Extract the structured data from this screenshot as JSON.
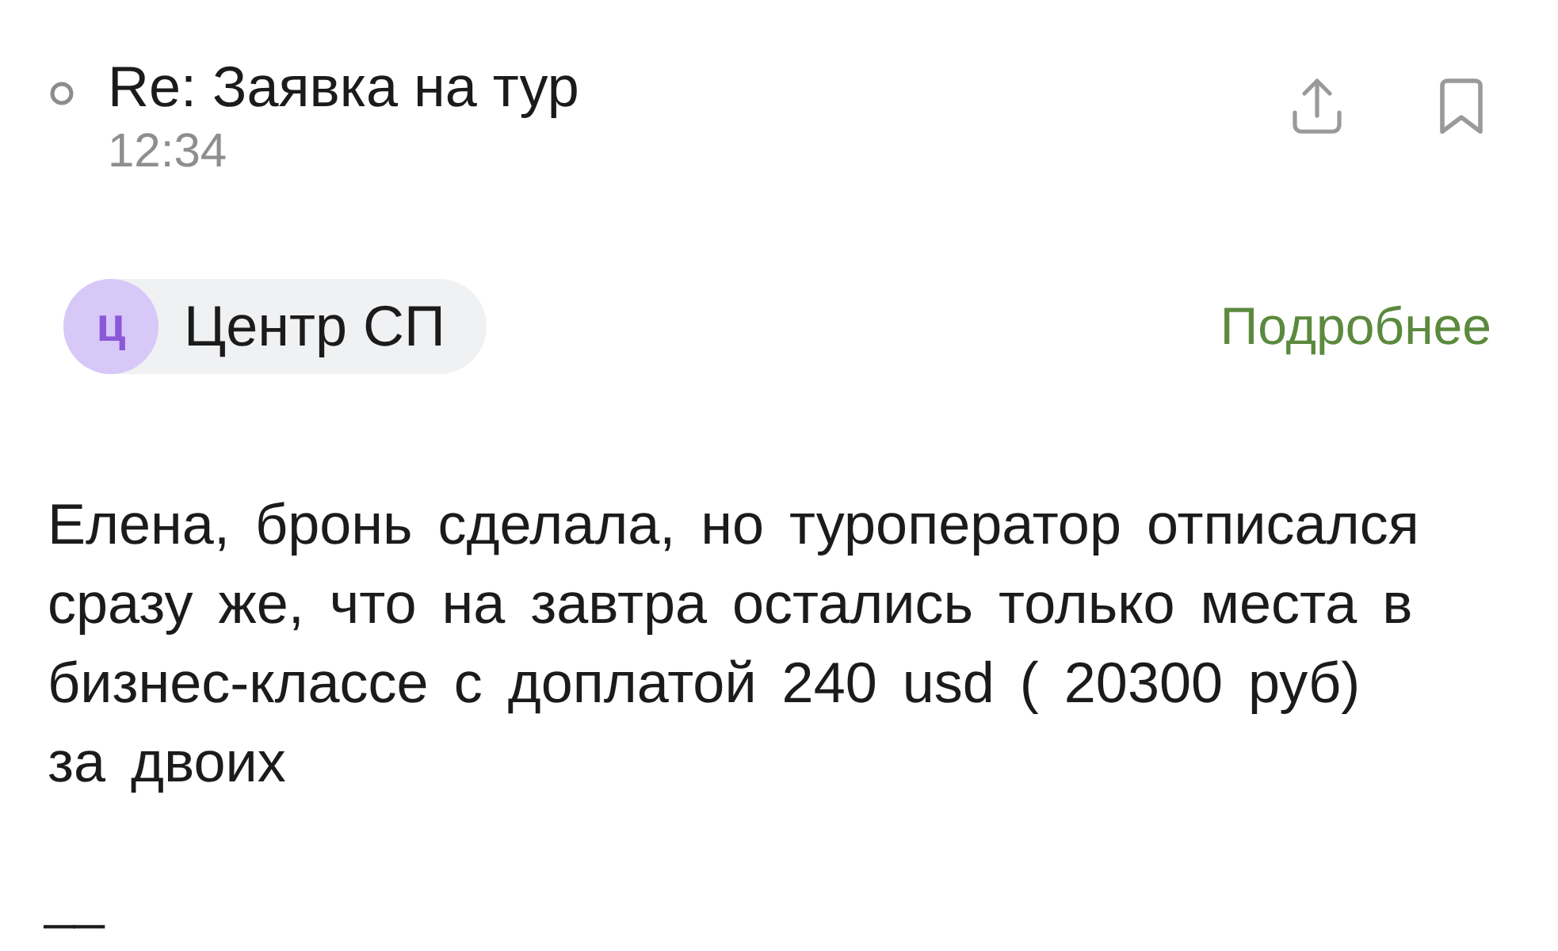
{
  "message": {
    "unread": false,
    "subject": "Re: Заявка на тур",
    "time": "12:34"
  },
  "sender": {
    "initial": "ц",
    "name": "Центр СП",
    "details_link": "Подробнее"
  },
  "body": "Елена, бронь сделала, но туроператор отписался сразу же, что на завтра остались только места в бизнес-классе с доплатой 240 usd ( 20300 руб) за двоих",
  "signature": "__"
}
